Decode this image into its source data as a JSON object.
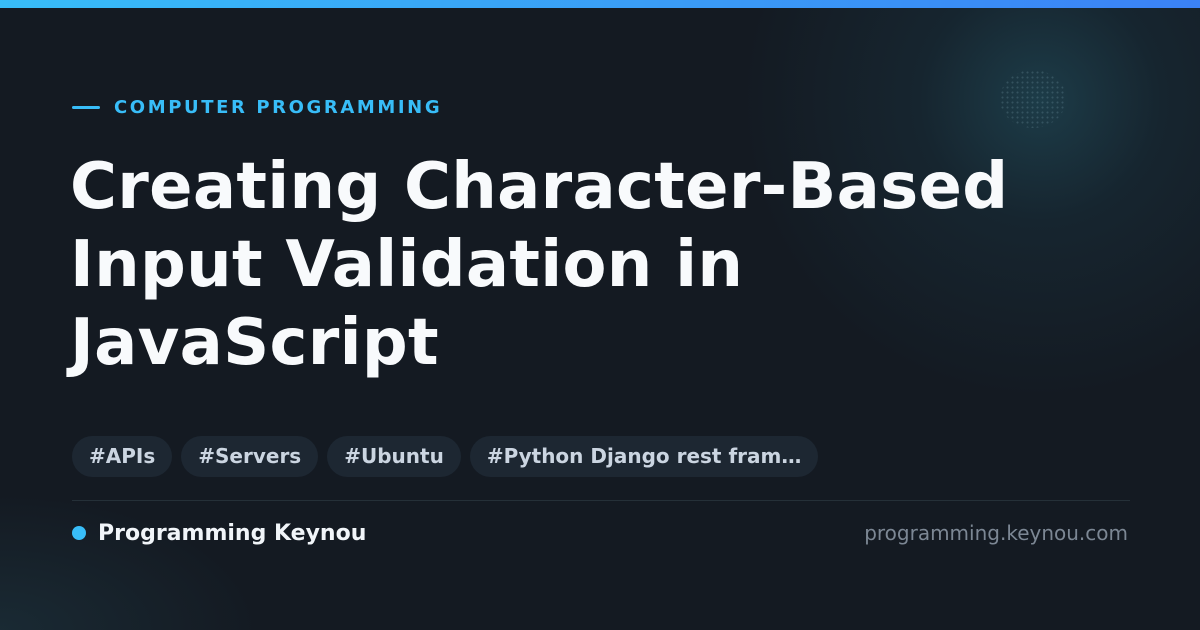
{
  "colors": {
    "background": "#141a22",
    "accent": "#38bdf8",
    "accent_gradient_end": "#3b82f6",
    "title": "#f8fafc",
    "tag_background": "#1d2732",
    "tag_text": "#cbd5e1",
    "muted": "#7c8794"
  },
  "category": "COMPUTER PROGRAMMING",
  "title": "Creating Character-Based Input Validation in JavaScript",
  "tags": [
    "#APIs",
    "#Servers",
    "#Ubuntu",
    "#Python Django rest fram…"
  ],
  "brand": {
    "name": "Programming Keynou",
    "domain": "programming.keynou.com"
  }
}
